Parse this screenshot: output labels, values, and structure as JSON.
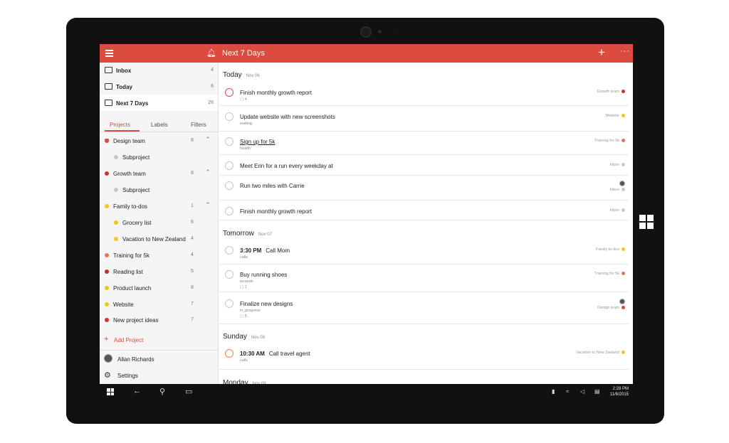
{
  "header": {
    "title": "Next 7 Days",
    "add_label": "+",
    "more_label": "···",
    "color": "#db4c3f"
  },
  "sidebar": {
    "nav": [
      {
        "label": "Inbox",
        "count": "4",
        "icon": "inbox-icon"
      },
      {
        "label": "Today",
        "count": "6",
        "icon": "calendar-today-icon"
      },
      {
        "label": "Next 7 Days",
        "count": "26",
        "icon": "calendar-week-icon"
      }
    ],
    "tabs": [
      "Projects",
      "Labels",
      "Filters"
    ],
    "projects": [
      {
        "label": "Design team",
        "count": "8",
        "color": "#db4c3f",
        "indent": false,
        "expanded": true,
        "icon": "person-icon"
      },
      {
        "label": "Subproject",
        "count": "",
        "color": "#c8c8c8",
        "indent": true
      },
      {
        "label": "Growth team",
        "count": "8",
        "color": "#d0312d",
        "indent": false,
        "expanded": true
      },
      {
        "label": "Subproject",
        "count": "",
        "color": "#c8c8c8",
        "indent": true
      },
      {
        "label": "Family to-dos",
        "count": "1",
        "color": "#f5c518",
        "indent": false,
        "expanded": true
      },
      {
        "label": "Grocery list",
        "count": "6",
        "color": "#f5c518",
        "indent": true
      },
      {
        "label": "Vacation to New Zealand",
        "count": "4",
        "color": "#f5c518",
        "indent": true
      },
      {
        "label": "Training for 5k",
        "count": "4",
        "color": "#e8735a",
        "indent": false
      },
      {
        "label": "Reading list",
        "count": "5",
        "color": "#b8312f",
        "indent": false
      },
      {
        "label": "Product launch",
        "count": "8",
        "color": "#f5c518",
        "indent": false
      },
      {
        "label": "Website",
        "count": "7",
        "color": "#f5c518",
        "indent": false
      },
      {
        "label": "New project ideas",
        "count": "7",
        "color": "#d0312d",
        "indent": false
      }
    ],
    "add_project": "Add Project",
    "user_name": "Allan Richards",
    "settings": "Settings"
  },
  "days": [
    {
      "name": "Today",
      "date": "Nov 06"
    },
    {
      "name": "Tomorrow",
      "date": "Nov 07"
    },
    {
      "name": "Sunday",
      "date": "Nov 08"
    },
    {
      "name": "Monday",
      "date": "Nov 09"
    }
  ],
  "tasks": [
    {
      "time": "",
      "title": "Finish monthly growth report",
      "sub": "",
      "comments": "4",
      "project": "Growth team",
      "color": "#d0312d"
    },
    {
      "time": "",
      "title": "Update website with new screenshots",
      "sub": "waiting",
      "comments": "",
      "project": "Website",
      "color": "#f5c518"
    },
    {
      "time": "",
      "title": "Sign up for 5k",
      "sub": "health",
      "comments": "",
      "project": "Training for 5k",
      "color": "#e8735a"
    },
    {
      "time": "",
      "title": "Meet Erin for a run every weekday at",
      "sub": "",
      "comments": "",
      "project": "Inbox",
      "color": "#c8c8c8"
    },
    {
      "time": "",
      "title": "Run two miles with Carrie",
      "sub": "",
      "comments": "",
      "project": "Inbox",
      "color": "#c8c8c8"
    },
    {
      "time": "",
      "title": "Finish monthly growth report",
      "sub": "",
      "comments": "",
      "project": "Inbox",
      "color": "#c8c8c8"
    },
    {
      "time": "3:30 PM",
      "title": "Call Mom",
      "sub": "calls",
      "comments": "",
      "project": "Family to-dos",
      "color": "#f5c518"
    },
    {
      "time": "",
      "title": "Buy running shoes",
      "sub": "errands",
      "comments": "1",
      "project": "Training for 5k",
      "color": "#e8735a"
    },
    {
      "time": "",
      "title": "Finalize new designs",
      "sub": "in_progress",
      "comments": "5",
      "project": "Design team",
      "color": "#db4c3f"
    },
    {
      "time": "10:30 AM",
      "title": "Call travel agent",
      "sub": "calls",
      "comments": "",
      "project": "Vacation to New Zealand",
      "color": "#f5c518"
    }
  ],
  "taskbar": {
    "time": "2:28 PM",
    "date": "11/6/2015"
  }
}
